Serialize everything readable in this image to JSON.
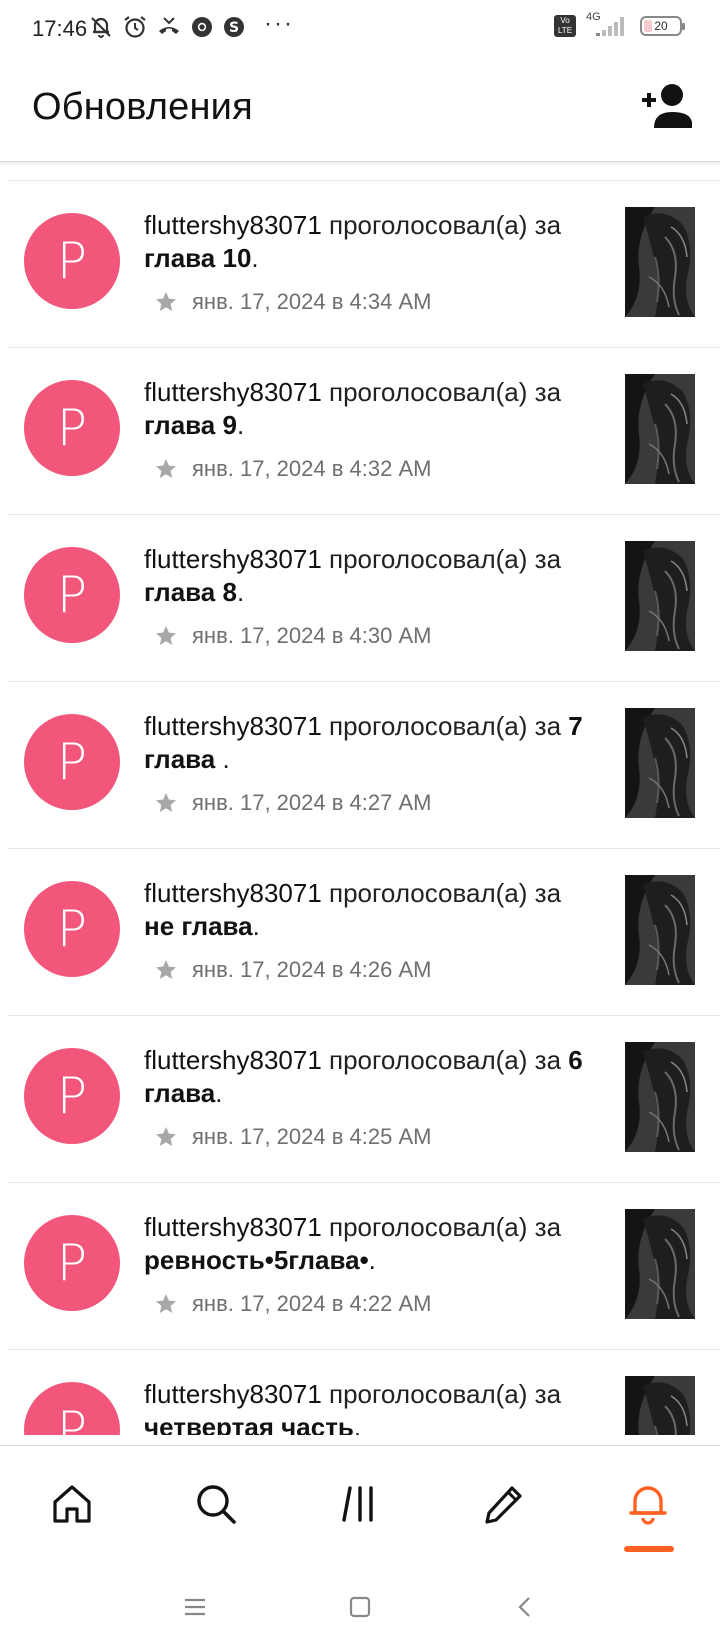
{
  "status_bar": {
    "time": "17:46",
    "more": "···",
    "network": "4G",
    "volte": "Vo LTE",
    "battery": "20"
  },
  "header": {
    "title": "Обновления",
    "add_user_icon": "person-add-icon"
  },
  "feed": {
    "items": [
      {
        "avatar": "P",
        "user": "fluttershy83071",
        "action": " проголосовал(а) ",
        "prep": "за ",
        "story": "глава 10",
        "end": ".",
        "date": "янв. 17, 2024 в 4:34 AM"
      },
      {
        "avatar": "P",
        "user": "fluttershy83071",
        "action": " проголосовал(а) ",
        "prep": "за ",
        "story": "глава 9",
        "end": ".",
        "date": "янв. 17, 2024 в 4:32 AM"
      },
      {
        "avatar": "P",
        "user": "fluttershy83071",
        "action": " проголосовал(а) ",
        "prep": "за ",
        "story": "глава 8",
        "end": ".",
        "date": "янв. 17, 2024 в 4:30 AM"
      },
      {
        "avatar": "P",
        "user": "fluttershy83071",
        "action": " проголосовал(а) ",
        "prep": "за ",
        "story": "7 глава ",
        "end": ".",
        "date": "янв. 17, 2024 в 4:27 AM"
      },
      {
        "avatar": "P",
        "user": "fluttershy83071",
        "action": " проголосовал(а) ",
        "prep": "за ",
        "story": "не глава",
        "end": ".",
        "date": "янв. 17, 2024 в 4:26 AM"
      },
      {
        "avatar": "P",
        "user": "fluttershy83071",
        "action": " проголосовал(а) ",
        "prep": "за ",
        "story": "6 глава",
        "end": ".",
        "date": "янв. 17, 2024 в 4:25 AM"
      },
      {
        "avatar": "P",
        "user": "fluttershy83071",
        "action": " проголосовал(а) ",
        "prep": "за ",
        "story": "ревность•5глава•",
        "end": ".",
        "date": "янв. 17, 2024 в 4:22 AM"
      },
      {
        "avatar": "P",
        "user": "fluttershy83071",
        "action": " проголосовал(а) ",
        "prep": "за ",
        "story": "четвертая часть",
        "end": ".",
        "date": ""
      }
    ]
  },
  "bottom_nav": {
    "items": [
      "home-icon",
      "search-icon",
      "library-icon",
      "write-icon",
      "notifications-icon"
    ],
    "active": "notifications-icon",
    "accent": "#ff6122"
  },
  "colors": {
    "avatar": "#f2567a",
    "accent": "#ff6122"
  }
}
